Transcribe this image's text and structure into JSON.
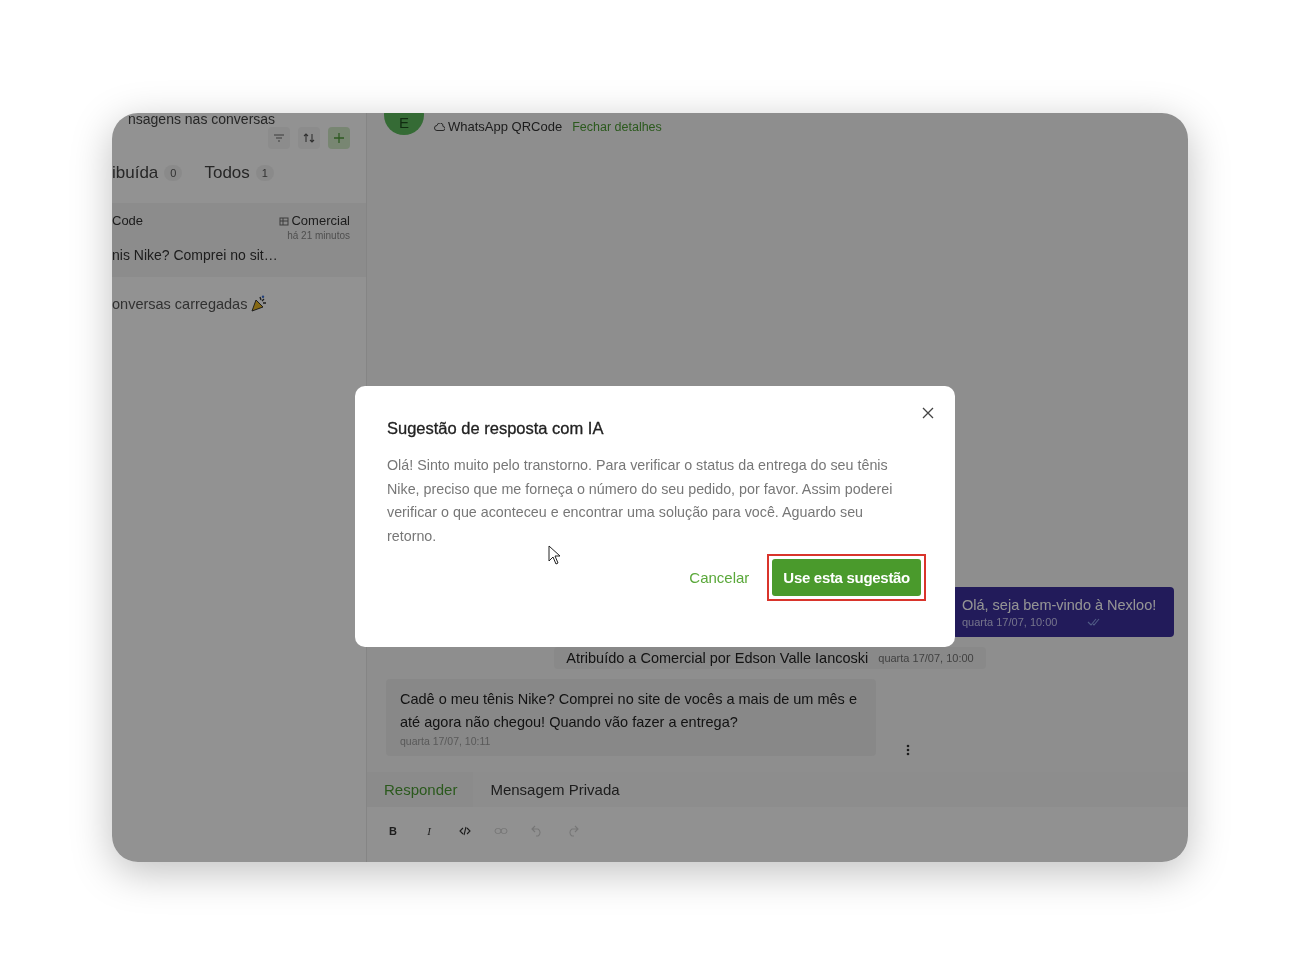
{
  "sidebar": {
    "heading": "nsagens nas conversas",
    "tabs": [
      {
        "label": "ibuída",
        "count": "0"
      },
      {
        "label": "Todos",
        "count": "1"
      }
    ],
    "conversations": [
      {
        "title": "Code",
        "queue": "Comercial",
        "time": "há 21 minutos",
        "preview": "nis Nike? Comprei no sit…"
      }
    ],
    "footer": "onversas carregadas"
  },
  "chat": {
    "avatar": "E",
    "channel": "WhatsApp QRCode",
    "close_details": "Fechar detalhes",
    "messages": [
      {
        "kind": "outgoing",
        "text": "Olá, seja bem-vindo à Nexloo!",
        "time": "quarta 17/07, 10:00"
      },
      {
        "kind": "system",
        "text": "Atribuído a Comercial por Edson Valle Iancoski",
        "time": "quarta 17/07, 10:00"
      },
      {
        "kind": "incoming",
        "text": "Cadê o meu tênis Nike? Comprei no site de vocês a mais de um mês e até agora não chegou! Quando vão fazer a entrega?",
        "time": "quarta 17/07, 10:11"
      }
    ],
    "composer_tabs": [
      {
        "label": "Responder",
        "selected": true
      },
      {
        "label": "Mensagem Privada",
        "selected": false
      }
    ],
    "toolbar": [
      {
        "kind": "bold",
        "label": "B",
        "disabled": false
      },
      {
        "kind": "italic",
        "label": "I",
        "disabled": false
      },
      {
        "kind": "code",
        "disabled": false
      },
      {
        "kind": "link",
        "disabled": true
      },
      {
        "kind": "undo",
        "disabled": true
      },
      {
        "kind": "redo",
        "disabled": true
      }
    ]
  },
  "dialog": {
    "title": "Sugestão de resposta com IA",
    "body": "Olá! Sinto muito pelo transtorno. Para verificar o status da entrega do seu tênis Nike, preciso que me forneça o número do seu pedido, por favor. Assim poderei verificar o que aconteceu e encontrar uma solução para você. Aguardo seu retorno.",
    "cancel": "Cancelar",
    "confirm": "Use esta sugestão",
    "confirm_highlighted": true
  }
}
